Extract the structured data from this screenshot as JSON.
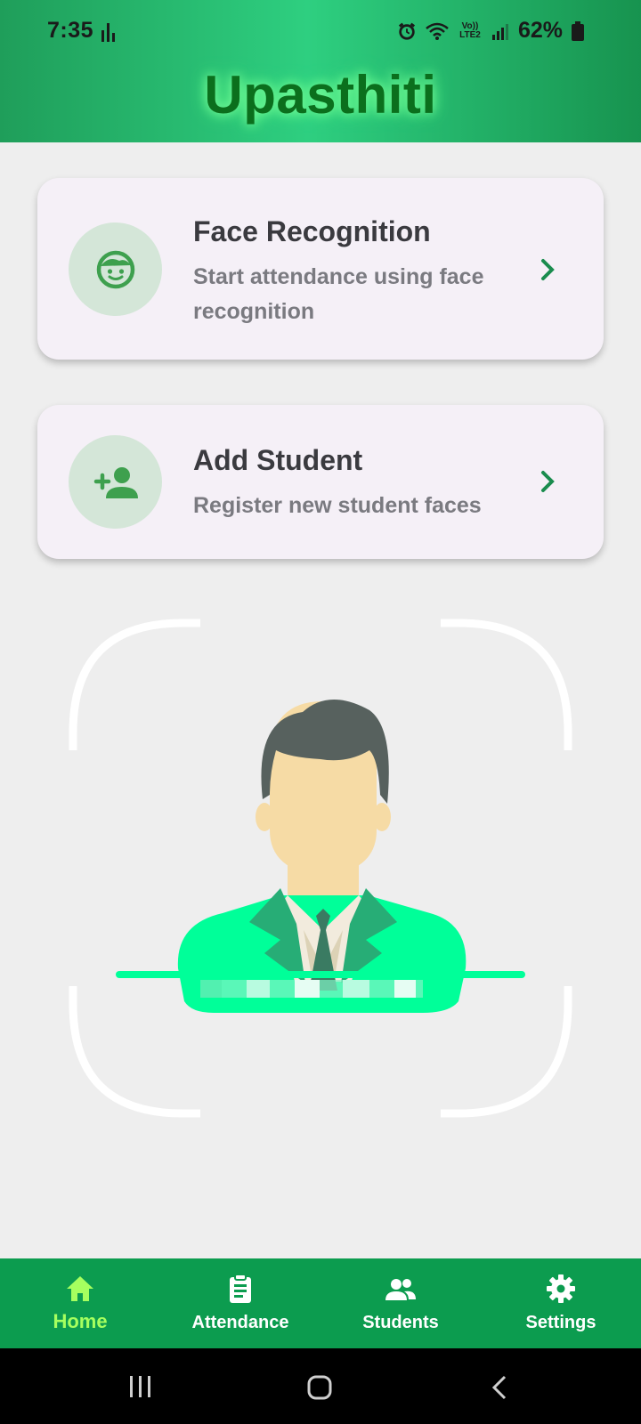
{
  "status_bar": {
    "time": "7:35",
    "battery": "62%",
    "network_label": "Vo)) LTE2"
  },
  "app": {
    "title": "Upasthiti"
  },
  "cards": [
    {
      "title": "Face Recognition",
      "subtitle": "Start attendance using face recognition",
      "icon": "face-icon"
    },
    {
      "title": "Add Student",
      "subtitle": "Register new student faces",
      "icon": "add-person-icon"
    }
  ],
  "illustration": {
    "icon": "face-scan-illustration"
  },
  "bottom_nav": {
    "items": [
      {
        "label": "Home",
        "icon": "home-icon",
        "active": true
      },
      {
        "label": "Attendance",
        "icon": "clipboard-icon",
        "active": false
      },
      {
        "label": "Students",
        "icon": "people-icon",
        "active": false
      },
      {
        "label": "Settings",
        "icon": "gear-icon",
        "active": false
      }
    ]
  },
  "colors": {
    "primary": "#0c9c4f",
    "active_nav": "#a6ff5f",
    "title": "#0b6f1d",
    "card_bg": "#f5f0f7",
    "icon_bg": "#d4e6d8"
  }
}
